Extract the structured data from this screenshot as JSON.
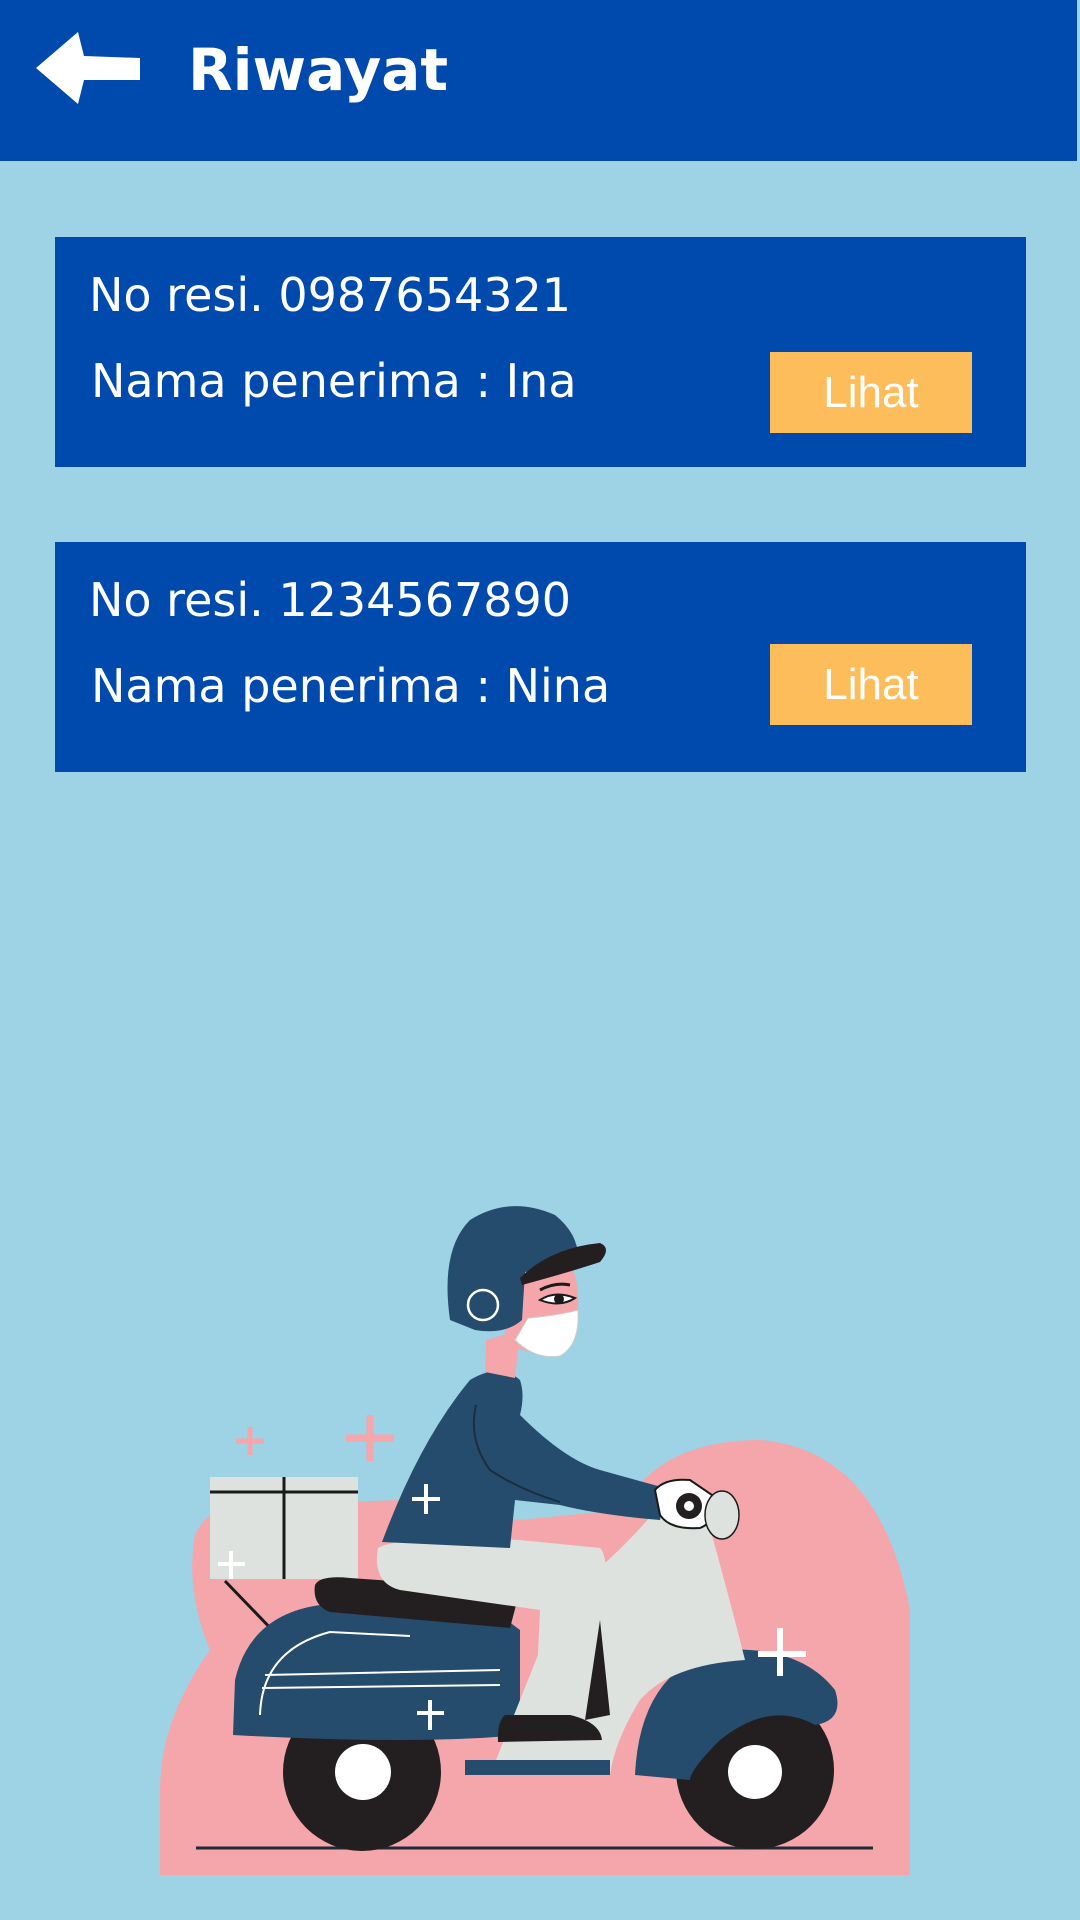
{
  "header": {
    "title": "Riwayat",
    "back_icon": "arrow-left-icon"
  },
  "history": [
    {
      "resi": "No resi. 0987654321",
      "penerima": "Nama penerima : Ina",
      "button_label": "Lihat"
    },
    {
      "resi": "No resi. 1234567890",
      "penerima": "Nama penerima : Nina",
      "button_label": "Lihat"
    }
  ],
  "illustration": {
    "subject": "delivery-scooter-courier"
  },
  "colors": {
    "background": "#9dd3e5",
    "primary": "#004aad",
    "button": "#fdbd5a",
    "text": "#ffffff"
  }
}
